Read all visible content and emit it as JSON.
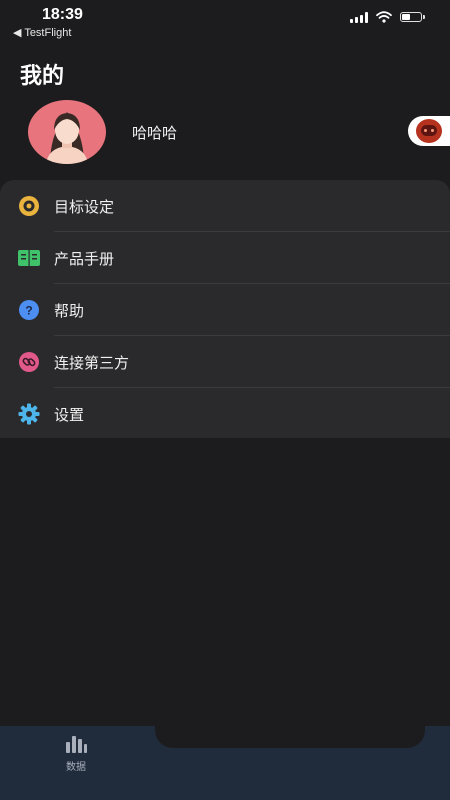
{
  "status_bar": {
    "time": "18:39",
    "back_app": "◀ TestFlight",
    "icons": [
      "signal-icon",
      "wifi-icon",
      "battery-icon"
    ],
    "battery_level": 0.45
  },
  "header": {
    "title": "我的"
  },
  "profile": {
    "name": "哈哈哈",
    "avatar_bg": "#e8747d"
  },
  "menu": {
    "items": [
      {
        "label": "目标设定",
        "icon": "target-icon",
        "color": "#e9b33d"
      },
      {
        "label": "产品手册",
        "icon": "book-icon",
        "color": "#3fc26a"
      },
      {
        "label": "帮助",
        "icon": "help-icon",
        "color": "#4c8ef2"
      },
      {
        "label": "连接第三方",
        "icon": "link-icon",
        "color": "#e0598a"
      },
      {
        "label": "设置",
        "icon": "gear-icon",
        "color": "#4db5ea"
      }
    ]
  },
  "tab_bar": {
    "items": [
      {
        "label": "数据",
        "icon": "bar-chart-icon"
      }
    ]
  }
}
